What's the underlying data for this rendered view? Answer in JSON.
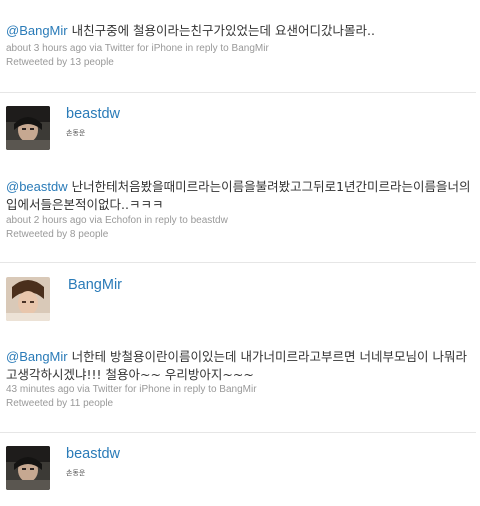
{
  "tweets": [
    {
      "mention": "@BangMir",
      "text": " 내친구중에 철용이라는친구가있었는데 요샌어디갔나몰라..",
      "time": "about 3 hours ago",
      "via_prefix": " via ",
      "source": "Twitter for iPhone",
      "reply_prefix": " in reply to ",
      "reply_to": "BangMir",
      "retweeted": "Retweeted by 13 people"
    },
    {
      "mention": "@beastdw",
      "text": " 난너한테처음봤을때미르라는이름을불려봤고그뒤로1년간미르라는이름을너의입에서들은본적이없다..ㅋㅋㅋ",
      "time": "about 2 hours ago",
      "via_prefix": " via ",
      "source": "Echofon",
      "reply_prefix": " in reply to ",
      "reply_to": "beastdw",
      "retweeted": "Retweeted by 8 people"
    },
    {
      "mention": "@BangMir",
      "text": " 너한테 방철용이란이름이있는데 내가너미르라고부르면 너네부모님이 나뭐라고생각하시겠냐!!! 철용아~~ 우리방아지~~~",
      "time": "43 minutes ago",
      "via_prefix": " via ",
      "source": "Twitter for iPhone",
      "reply_prefix": " in reply to ",
      "reply_to": "BangMir",
      "retweeted": "Retweeted by 11 people"
    }
  ],
  "users": [
    {
      "username": "beastdw",
      "realname": "손동운"
    },
    {
      "username": "BangMir",
      "realname": ""
    },
    {
      "username": "beastdw",
      "realname": "손동운"
    }
  ],
  "colors": {
    "link": "#2a7bb8",
    "meta": "#999999",
    "divider": "#e6e6e6"
  }
}
